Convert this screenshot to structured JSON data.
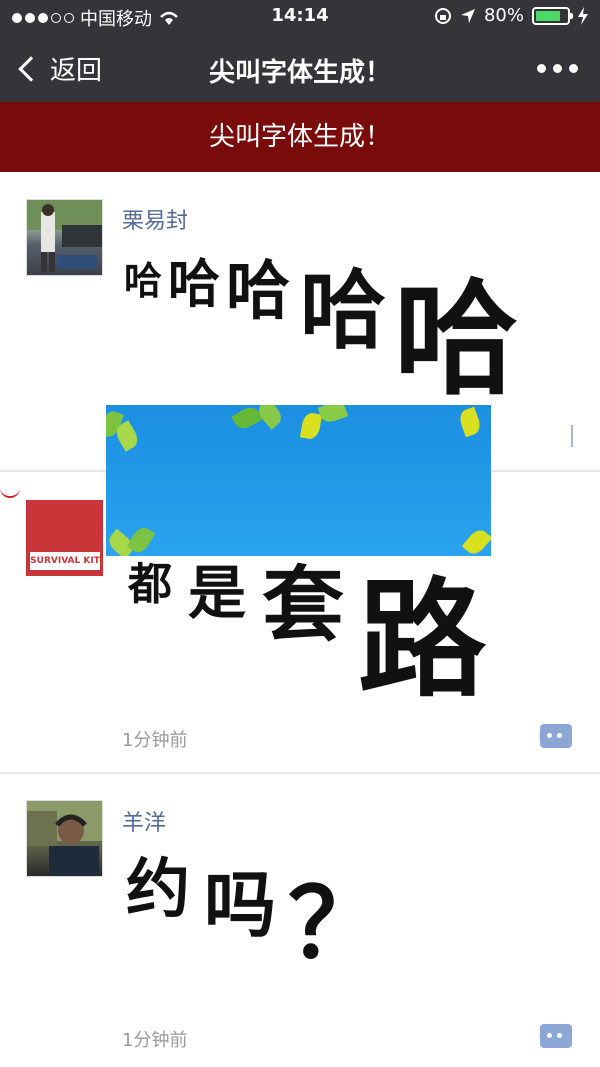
{
  "status_bar": {
    "carrier": "中国移动",
    "time": "14:14",
    "battery": "80%",
    "battery_level": 0.8
  },
  "nav": {
    "back_label": "返回",
    "title": "尖叫字体生成！"
  },
  "banner": {
    "text": "尖叫字体生成！"
  },
  "posts": [
    {
      "username": "栗易封",
      "chars": [
        "哈",
        "哈",
        "哈",
        "哈",
        "哈"
      ],
      "time_ago": ""
    },
    {
      "username": "",
      "chars": [
        "都",
        "是",
        "套",
        "路"
      ],
      "time_ago": "1分钟前"
    },
    {
      "username": "羊洋",
      "chars": [
        "约",
        "吗",
        "？"
      ],
      "time_ago": "1分钟前"
    }
  ],
  "colors": {
    "nav_bg": "#353539",
    "banner_bg": "#7a0b0b",
    "username": "#556b95",
    "ad_bg": "#1c8fe0"
  },
  "icons": {
    "signal": "signal-dots-icon",
    "wifi": "wifi-icon",
    "lock": "rotation-lock-icon",
    "location": "location-arrow-icon",
    "battery": "battery-icon",
    "charging": "charging-bolt-icon",
    "back": "chevron-left-icon",
    "more": "more-dots-icon",
    "comment": "comment-icon"
  }
}
